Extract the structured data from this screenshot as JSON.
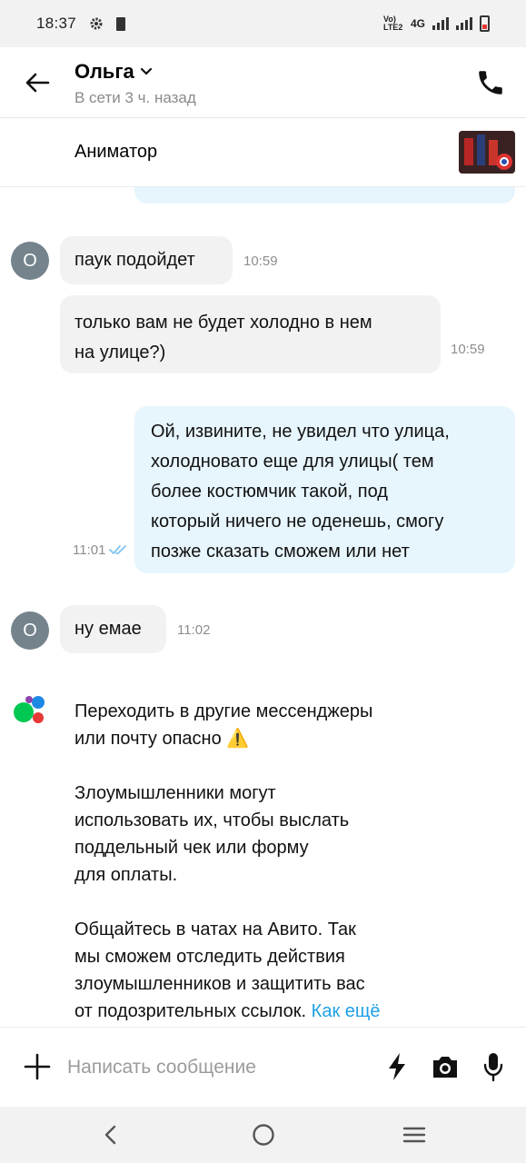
{
  "status_bar": {
    "time": "18:37",
    "network_label": "Vo) LTE2",
    "network_type": "4G"
  },
  "header": {
    "contact_name": "Ольга",
    "contact_status": "В сети 3 ч. назад"
  },
  "listing": {
    "title": "Аниматор"
  },
  "messages": [
    {
      "direction": "in",
      "avatar_letter": "О",
      "text": "паук подойдет",
      "time": "10:59"
    },
    {
      "direction": "in",
      "text_lines": [
        "только вам не будет холодно в нем",
        "на улице?)"
      ],
      "time": "10:59"
    },
    {
      "direction": "out",
      "text_lines": [
        "Ой, извините, не увидел что улица,",
        "холодновато еще для улицы( тем",
        "более костюмчик такой, под",
        "который ничего не оденешь, смогу",
        "позже сказать сможем или нет"
      ],
      "time": "11:01",
      "status": "read"
    },
    {
      "direction": "in",
      "avatar_letter": "О",
      "text": "ну емае",
      "time": "11:02"
    }
  ],
  "system_notice": {
    "paragraph1_lines": [
      "Переходить в другие мессенджеры",
      "или почту опасно ⚠️"
    ],
    "paragraph2_lines": [
      "Злоумышленники могут",
      "использовать их, чтобы выслать",
      "поддельный чек или форму",
      "для оплаты."
    ],
    "paragraph3_lines": [
      "Общайтесь в чатах на Авито. Так",
      "мы сможем отследить действия",
      "злоумышленников и защитить вас"
    ],
    "paragraph3_last_text": "от подозрительных ссылок. ",
    "link_text": "Как ещё"
  },
  "composer": {
    "placeholder": "Написать сообщение"
  },
  "colors": {
    "incoming_bubble": "#f2f2f2",
    "outgoing_bubble": "#e7f5fd",
    "link": "#1ea0e6",
    "avatar": "#74838c",
    "read_check": "#7ec3ef"
  },
  "icons": {
    "back": "arrow-left-icon",
    "call": "phone-icon",
    "add": "plus-icon",
    "quick": "lightning-icon",
    "camera": "camera-icon",
    "mic": "microphone-icon"
  }
}
